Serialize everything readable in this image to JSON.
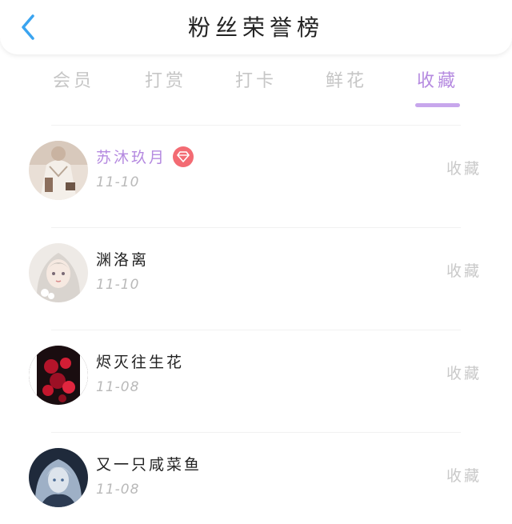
{
  "header": {
    "title": "粉丝荣誉榜",
    "back_icon": "chevron-left-icon",
    "accent": "#3aa4f0"
  },
  "tabs": [
    {
      "label": "会员",
      "active": false
    },
    {
      "label": "打赏",
      "active": false
    },
    {
      "label": "打卡",
      "active": false
    },
    {
      "label": "鲜花",
      "active": false
    },
    {
      "label": "收藏",
      "active": true
    }
  ],
  "colors": {
    "active_tab": "#b58ae0",
    "inactive_tab": "#c6c6c6",
    "vip_name": "#b58ae0",
    "vip_badge": "#f36b73"
  },
  "fans": [
    {
      "name": "苏沐玖月",
      "date": "11-10",
      "action": "收藏",
      "vip": true,
      "avatar_icon": "avatar-image"
    },
    {
      "name": "渊洛离",
      "date": "11-10",
      "action": "收藏",
      "vip": false,
      "avatar_icon": "avatar-image"
    },
    {
      "name": "烬灭往生花",
      "date": "11-08",
      "action": "收藏",
      "vip": false,
      "avatar_icon": "avatar-image"
    },
    {
      "name": "又一只咸菜鱼",
      "date": "11-08",
      "action": "收藏",
      "vip": false,
      "avatar_icon": "avatar-image"
    }
  ]
}
